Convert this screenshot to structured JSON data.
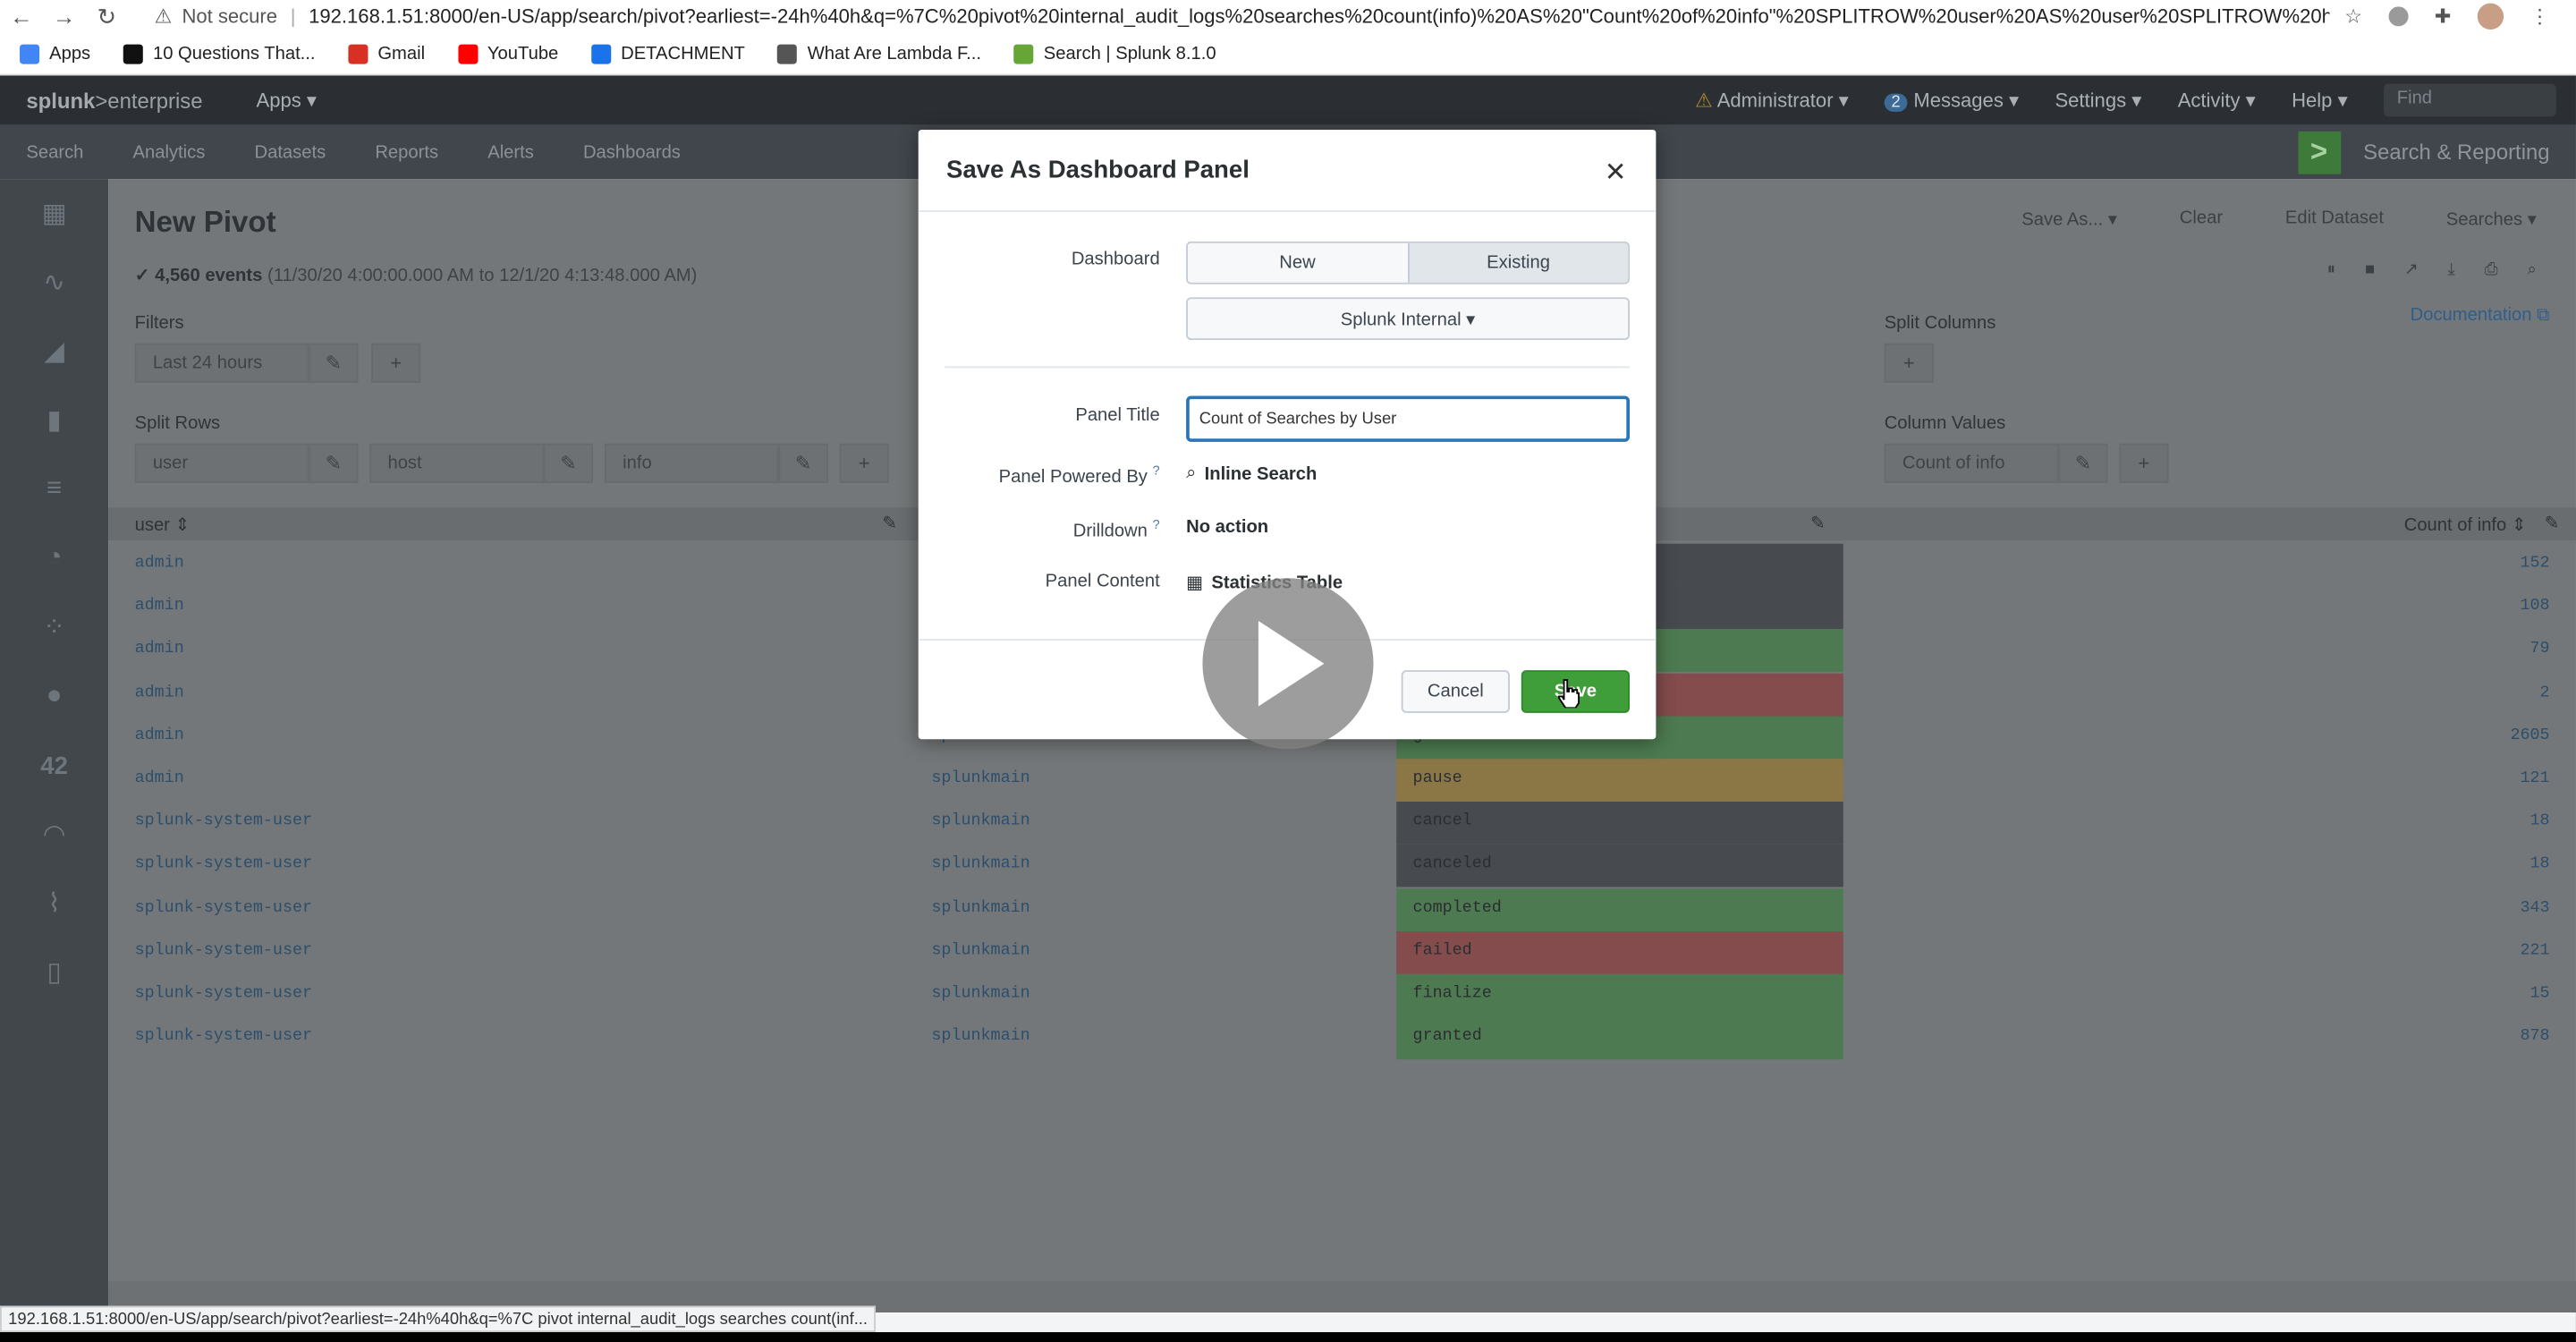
{
  "browser": {
    "security_label": "Not secure",
    "url": "192.168.1.51:8000/en-US/app/search/pivot?earliest=-24h%40h&q=%7C%20pivot%20internal_audit_logs%20searches%20count(info)%20AS%20\"Count%20of%20info\"%20SPLITROW%20user%20AS%20user%20SPLITROW%20host%20AS%20hos...",
    "bookmarks": [
      {
        "label": "Apps",
        "icon": "apps-grid-icon",
        "color": "#4285f4"
      },
      {
        "label": "10 Questions That...",
        "icon": "bookmark-i-icon",
        "color": "#111111"
      },
      {
        "label": "Gmail",
        "icon": "gmail-icon",
        "color": "#d93025"
      },
      {
        "label": "YouTube",
        "icon": "youtube-icon",
        "color": "#ff0000"
      },
      {
        "label": "DETACHMENT",
        "icon": "detachment-icon",
        "color": "#1a73e8"
      },
      {
        "label": "What Are Lambda F...",
        "icon": "lambda-icon",
        "color": "#555555"
      },
      {
        "label": "Search | Splunk 8.1.0",
        "icon": "splunk-icon",
        "color": "#65a637"
      }
    ],
    "status_url": "192.168.1.51:8000/en-US/app/search/pivot?earliest=-24h%40h&q=%7C pivot internal_audit_logs searches count(inf..."
  },
  "splunk": {
    "logo_main": "splunk",
    "logo_sub": ">enterprise",
    "apps_menu": "Apps ▾",
    "top_right": {
      "admin": "Administrator ▾",
      "messages_count": "2",
      "messages": "Messages ▾",
      "settings": "Settings ▾",
      "activity": "Activity ▾",
      "help": "Help ▾",
      "find_placeholder": "Find"
    },
    "app_nav": [
      "Search",
      "Analytics",
      "Datasets",
      "Reports",
      "Alerts",
      "Dashboards"
    ],
    "app_title": "Search & Reporting",
    "page_title": "New Pivot",
    "events_count": "✓ 4,560 events",
    "events_range": "(11/30/20 4:00:00.000 AM to 12/1/20 4:13:48.000 AM)",
    "toolbar": {
      "save_as": "Save As... ▾",
      "clear": "Clear",
      "edit_dataset": "Edit Dataset",
      "searches": "Searches ▾"
    },
    "documentation": "Documentation ⧉",
    "filters_label": "Filters",
    "filter_value": "Last 24 hours",
    "split_rows_label": "Split Rows",
    "split_rows": [
      "user",
      "host",
      "info"
    ],
    "split_columns_label": "Split Columns",
    "column_values_label": "Column Values",
    "column_value": "Count of info",
    "table": {
      "col_user": "user ⇕",
      "col_count": "Count of info ⇕",
      "rows": [
        {
          "user": "admin",
          "host": "",
          "info": "",
          "count": "152",
          "color": "#474b4f"
        },
        {
          "user": "admin",
          "host": "",
          "info": "",
          "count": "108",
          "color": "#474b4f"
        },
        {
          "user": "admin",
          "host": "",
          "info": "",
          "count": "79",
          "color": "#4d7a50"
        },
        {
          "user": "admin",
          "host": "",
          "info": "",
          "count": "2",
          "color": "#844c4c"
        },
        {
          "user": "admin",
          "host": "splunkmain",
          "info": "granted",
          "count": "2605",
          "color": "#4d7a50"
        },
        {
          "user": "admin",
          "host": "splunkmain",
          "info": "pause",
          "count": "121",
          "color": "#8b7746"
        },
        {
          "user": "splunk-system-user",
          "host": "splunkmain",
          "info": "cancel",
          "count": "18",
          "color": "#474b4f"
        },
        {
          "user": "splunk-system-user",
          "host": "splunkmain",
          "info": "canceled",
          "count": "18",
          "color": "#474b4f"
        },
        {
          "user": "splunk-system-user",
          "host": "splunkmain",
          "info": "completed",
          "count": "343",
          "color": "#4d7a50"
        },
        {
          "user": "splunk-system-user",
          "host": "splunkmain",
          "info": "failed",
          "count": "221",
          "color": "#844c4c"
        },
        {
          "user": "splunk-system-user",
          "host": "splunkmain",
          "info": "finalize",
          "count": "15",
          "color": "#4d7a50"
        },
        {
          "user": "splunk-system-user",
          "host": "splunkmain",
          "info": "granted",
          "count": "878",
          "color": "#4d7a50"
        }
      ]
    }
  },
  "modal": {
    "title": "Save As Dashboard Panel",
    "dashboard_label": "Dashboard",
    "dashboard_new": "New",
    "dashboard_existing": "Existing",
    "dashboard_selected": "Splunk Internal ▾",
    "panel_title_label": "Panel Title",
    "panel_title_value": "Count of Searches by User",
    "powered_by_label": "Panel Powered By",
    "powered_by_value": "Inline Search",
    "drilldown_label": "Drilldown",
    "drilldown_value": "No action",
    "content_label": "Panel Content",
    "content_value": "Statistics Table",
    "help_mark": "?",
    "cancel": "Cancel",
    "save": "Save",
    "accent_color": "#3f9e3a",
    "focus_color": "#2c75b5"
  }
}
